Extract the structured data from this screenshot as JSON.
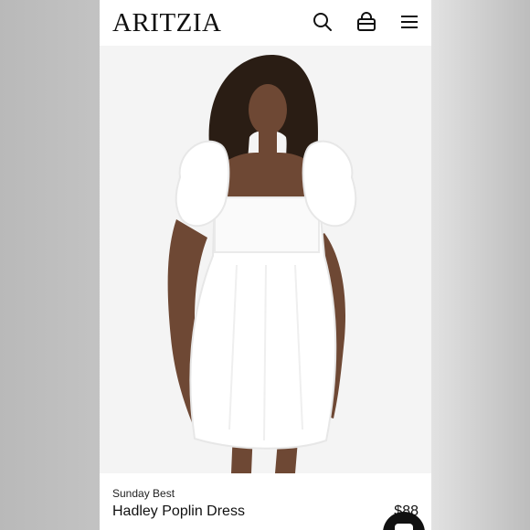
{
  "header": {
    "logo_text": "ARITZIA",
    "icons": [
      "search-icon",
      "bag-icon",
      "menu-icon"
    ]
  },
  "product": {
    "collection": "Sunday Best",
    "name": "Hadley Poplin Dress",
    "price": "$88"
  },
  "colors": {
    "background": "#ffffff",
    "text": "#111111",
    "hero_bg": "#f4f4f4"
  },
  "icons": {
    "chat": "chat-icon"
  }
}
